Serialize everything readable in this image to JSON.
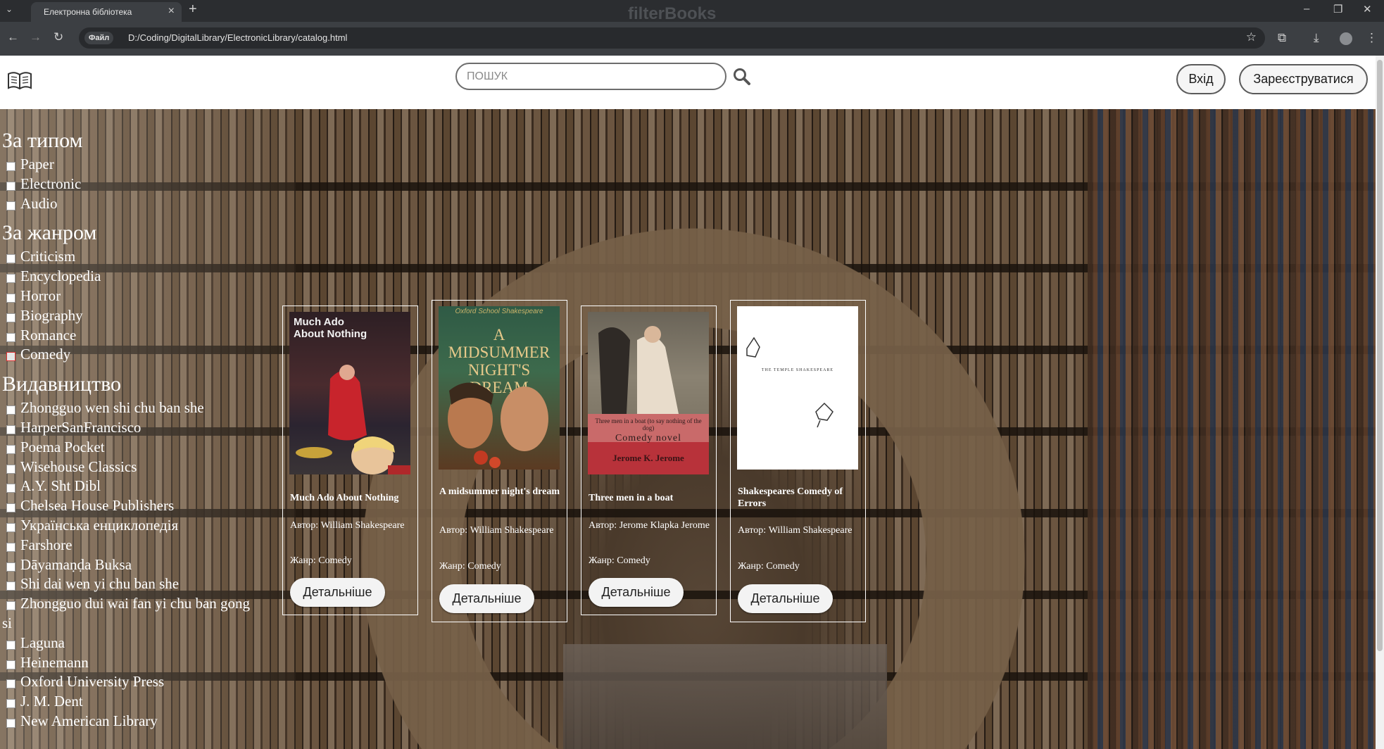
{
  "browser": {
    "tab_title": "Електронна бібліотека",
    "new_tab": "+",
    "window_title": "filterBooks",
    "site_chip": "Файл",
    "url": "D:/Coding/DigitalLibrary/ElectronicLibrary/catalog.html"
  },
  "header": {
    "search_placeholder": "ПОШУК",
    "login_label": "Вхід",
    "register_label": "Зареєструватися"
  },
  "filters": {
    "type": {
      "heading": "За типом",
      "items": [
        "Paper",
        "Electronic",
        "Audio"
      ]
    },
    "genre": {
      "heading": "За жанром",
      "items": [
        "Criticism",
        "Encyclopedia",
        "Horror",
        "Biography",
        "Romance",
        "Comedy"
      ],
      "checked": "Comedy"
    },
    "publisher": {
      "heading": "Видавництво",
      "items": [
        "Zhongguo wen shi chu ban she",
        "HarperSanFrancisco",
        "Poema Pocket",
        "Wisehouse Classics",
        "A.Y. Sht Dibl",
        "Chelsea House Publishers",
        "Українська енциклопедія",
        "Farshore",
        "Dāyamaṇḍa Buksa",
        "Shi dai wen yi chu ban she",
        "Zhongguo dui wai fan yi chu ban gong si",
        "Laguna",
        "Heinemann",
        "Oxford University Press",
        "J. M. Dent",
        "New American Library"
      ]
    }
  },
  "books": [
    {
      "title": "Much Ado About Nothing",
      "author": "Автор: William Shakespeare",
      "genre": "Жанр: Comedy",
      "cover_text": "Much Ado\nAbout Nothing",
      "details_label": "Детальніше"
    },
    {
      "title": "A midsummer night's dream",
      "author": "Автор: William Shakespeare",
      "genre": "Жанр: Comedy",
      "cover_series": "Oxford School Shakespeare",
      "cover_text": "A MIDSUMMER NIGHT'S DREAM",
      "details_label": "Детальніше"
    },
    {
      "title": "Three men in a boat",
      "author": "Автор: Jerome Klapka Jerome",
      "genre": "Жанр: Comedy",
      "cover_subtitle": "Three men in a boat (to say nothing of the dog)",
      "cover_kind": "Comedy novel",
      "cover_author": "Jerome K. Jerome",
      "details_label": "Детальніше"
    },
    {
      "title": "Shakespeares Comedy of Errors",
      "author": "Автор: William Shakespeare",
      "genre": "Жанр: Comedy",
      "cover_series": "THE TEMPLE SHAKESPEARE",
      "details_label": "Детальніше"
    }
  ]
}
